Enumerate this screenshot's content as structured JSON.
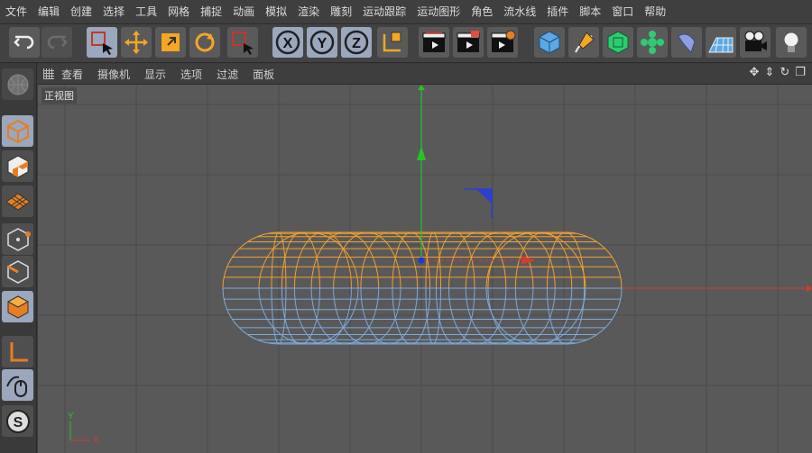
{
  "menubar": {
    "items": [
      "文件",
      "编辑",
      "创建",
      "选择",
      "工具",
      "网格",
      "捕捉",
      "动画",
      "模拟",
      "渲染",
      "雕刻",
      "运动跟踪",
      "运动图形",
      "角色",
      "流水线",
      "插件",
      "脚本",
      "窗口",
      "帮助"
    ]
  },
  "toolbar": {
    "axis_x": "X",
    "axis_y": "Y",
    "axis_z": "Z"
  },
  "viewport_menu": {
    "items": [
      "查看",
      "摄像机",
      "显示",
      "选项",
      "过滤",
      "面板"
    ]
  },
  "viewport": {
    "label": "正视图",
    "axis_x": "X",
    "axis_y": "Y"
  },
  "colors": {
    "accent_selected": "#9aa7bd",
    "wire_top": "#f0a030",
    "wire_bottom": "#7ea9d8",
    "axis_y": "#26c326",
    "axis_x": "#d33c2e",
    "origin": "#2336d8"
  }
}
